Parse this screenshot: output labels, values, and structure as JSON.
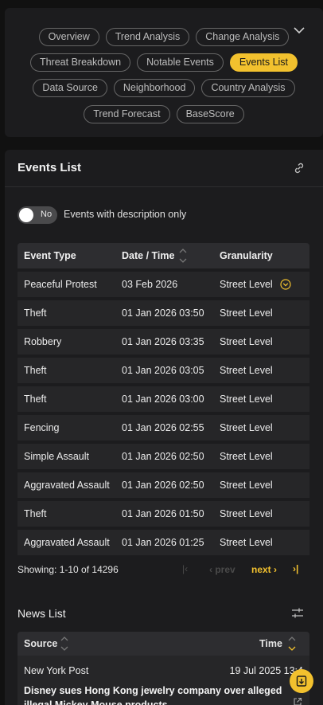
{
  "nav": {
    "chips": [
      {
        "label": "Overview"
      },
      {
        "label": "Trend Analysis"
      },
      {
        "label": "Change Analysis"
      },
      {
        "label": "Threat Breakdown"
      },
      {
        "label": "Notable Events"
      },
      {
        "label": "Events List",
        "active": true
      },
      {
        "label": "Data Source"
      },
      {
        "label": "Neighborhood"
      },
      {
        "label": "Country Analysis"
      },
      {
        "label": "Trend Forecast"
      },
      {
        "label": "BaseScore"
      }
    ],
    "toggle_icon": "chevron-down-icon"
  },
  "events": {
    "title": "Events List",
    "link_icon": "link-icon",
    "filter_toggle": {
      "state_label": "No",
      "label": "Events with description only"
    },
    "columns": {
      "type": "Event Type",
      "date": "Date / Time",
      "granularity": "Granularity"
    },
    "rows": [
      {
        "type": "Peaceful Protest",
        "date": "03 Feb 2026",
        "granularity": "Street Level",
        "expandable": true
      },
      {
        "type": "Theft",
        "date": "01 Jan 2026 03:50",
        "granularity": "Street Level"
      },
      {
        "type": "Robbery",
        "date": "01 Jan 2026 03:35",
        "granularity": "Street Level"
      },
      {
        "type": "Theft",
        "date": "01 Jan 2026 03:05",
        "granularity": "Street Level"
      },
      {
        "type": "Theft",
        "date": "01 Jan 2026 03:00",
        "granularity": "Street Level"
      },
      {
        "type": "Fencing",
        "date": "01 Jan 2026 02:55",
        "granularity": "Street Level"
      },
      {
        "type": "Simple Assault",
        "date": "01 Jan 2026 02:50",
        "granularity": "Street Level"
      },
      {
        "type": "Aggravated Assault",
        "date": "01 Jan 2026 02:50",
        "granularity": "Street Level"
      },
      {
        "type": "Theft",
        "date": "01 Jan 2026 01:50",
        "granularity": "Street Level"
      },
      {
        "type": "Aggravated Assault",
        "date": "01 Jan 2026 01:25",
        "granularity": "Street Level"
      }
    ],
    "pager": {
      "info": "Showing: 1-10 of 14296",
      "first": "|‹",
      "prev": "‹ prev",
      "next": "next ›",
      "last": "›|"
    }
  },
  "news": {
    "title": "News List",
    "columns": {
      "source": "Source",
      "time": "Time"
    },
    "item": {
      "source": "New York Post",
      "time": "19 Jul 2025 13:4",
      "headline": "Disney sues Hong Kong jewelry company over alleged illegal Mickey Mouse products"
    },
    "download_icon": "download-icon"
  },
  "colors": {
    "accent": "#f2c12e",
    "card": "#1c1c1e",
    "row": "#262628",
    "header": "#2d2d30"
  }
}
